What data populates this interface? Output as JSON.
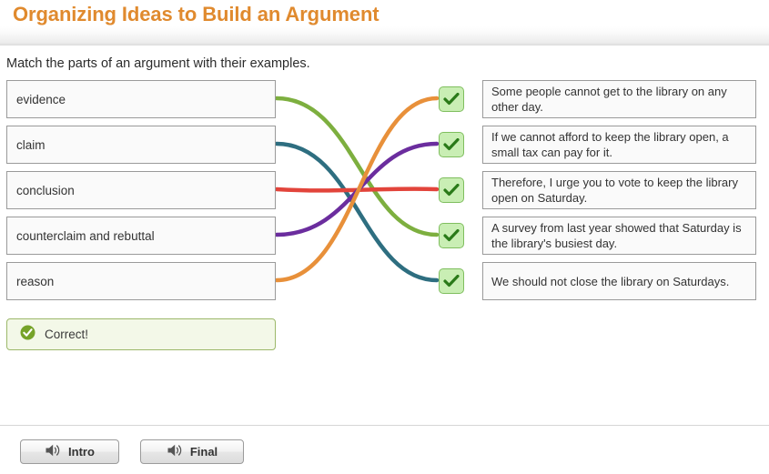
{
  "header": {
    "title": "Organizing Ideas to Build an Argument"
  },
  "instruction": "Match the parts of an argument with their examples.",
  "match": {
    "left_items": [
      {
        "label": "evidence"
      },
      {
        "label": "claim"
      },
      {
        "label": "conclusion"
      },
      {
        "label": "counterclaim and rebuttal"
      },
      {
        "label": "reason"
      }
    ],
    "right_items": [
      {
        "text": "Some people cannot get to the library on any other day."
      },
      {
        "text": "If we cannot afford to keep the library open, a small tax can pay for it."
      },
      {
        "text": "Therefore, I urge you to vote to keep the library open on Saturday."
      },
      {
        "text": "A survey from last year showed that Saturday is the library's busiest day."
      },
      {
        "text": "We should not close the library on Saturdays."
      }
    ],
    "result_markers": [
      {
        "state": "correct",
        "icon": "check-icon"
      },
      {
        "state": "correct",
        "icon": "check-icon"
      },
      {
        "state": "correct",
        "icon": "check-icon"
      },
      {
        "state": "correct",
        "icon": "check-icon"
      },
      {
        "state": "correct",
        "icon": "check-icon"
      }
    ],
    "connections": [
      {
        "from": "evidence",
        "to_index": 4,
        "color": "#7daf3f"
      },
      {
        "from": "claim",
        "to_index": 5,
        "color": "#2e6e80"
      },
      {
        "from": "conclusion",
        "to_index": 3,
        "color": "#e2443b"
      },
      {
        "from": "counterclaim and rebuttal",
        "to_index": 2,
        "color": "#6b2d9e"
      },
      {
        "from": "reason",
        "to_index": 1,
        "color": "#e8903a"
      }
    ]
  },
  "feedback": {
    "text": "Correct!",
    "icon": "check-circle-icon",
    "state": "correct"
  },
  "footer": {
    "buttons": [
      {
        "label": "Intro",
        "icon": "speaker-icon"
      },
      {
        "label": "Final",
        "icon": "speaker-icon"
      }
    ]
  },
  "colors": {
    "title": "#e08a2e",
    "line_green": "#7daf3f",
    "line_teal": "#2e6e80",
    "line_red": "#e2443b",
    "line_purple": "#6b2d9e",
    "line_orange": "#e8903a",
    "check_fill": "#c9eeb4",
    "check_mark": "#2a7a19",
    "feedback_bg": "#f3f8e8",
    "feedback_border": "#9cb86a"
  }
}
